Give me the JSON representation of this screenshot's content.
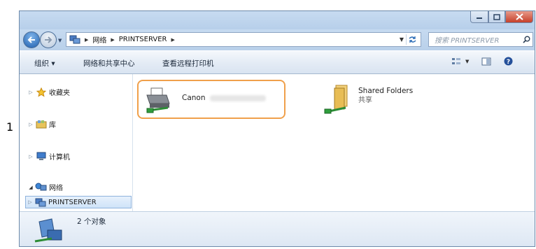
{
  "step_number": "1",
  "window": {
    "caption_buttons": {
      "minimize": "minimize-icon",
      "maximize": "maximize-icon",
      "close": "close-icon"
    }
  },
  "address": {
    "breadcrumbs": [
      "网络",
      "PRINTSERVER"
    ],
    "search_placeholder": "搜索 PRINTSERVER"
  },
  "toolbar": {
    "organize": "组织 ▾",
    "network_sharing": "网络和共享中心",
    "view_printers": "查看远程打印机"
  },
  "navigation": {
    "favorites": "收藏夹",
    "libraries": "库",
    "computer": "计算机",
    "network": "网络",
    "printserver": "PRINTSERVER"
  },
  "files": [
    {
      "name": "Canon",
      "subtitle": "",
      "icon": "printer-icon"
    },
    {
      "name": "Shared Folders",
      "subtitle": "共享",
      "icon": "shared-folder-icon"
    }
  ],
  "status": {
    "count": "2 个对象"
  },
  "colors": {
    "selection_outline": "#f0a04b",
    "window_frame": "#bcd3ec"
  }
}
